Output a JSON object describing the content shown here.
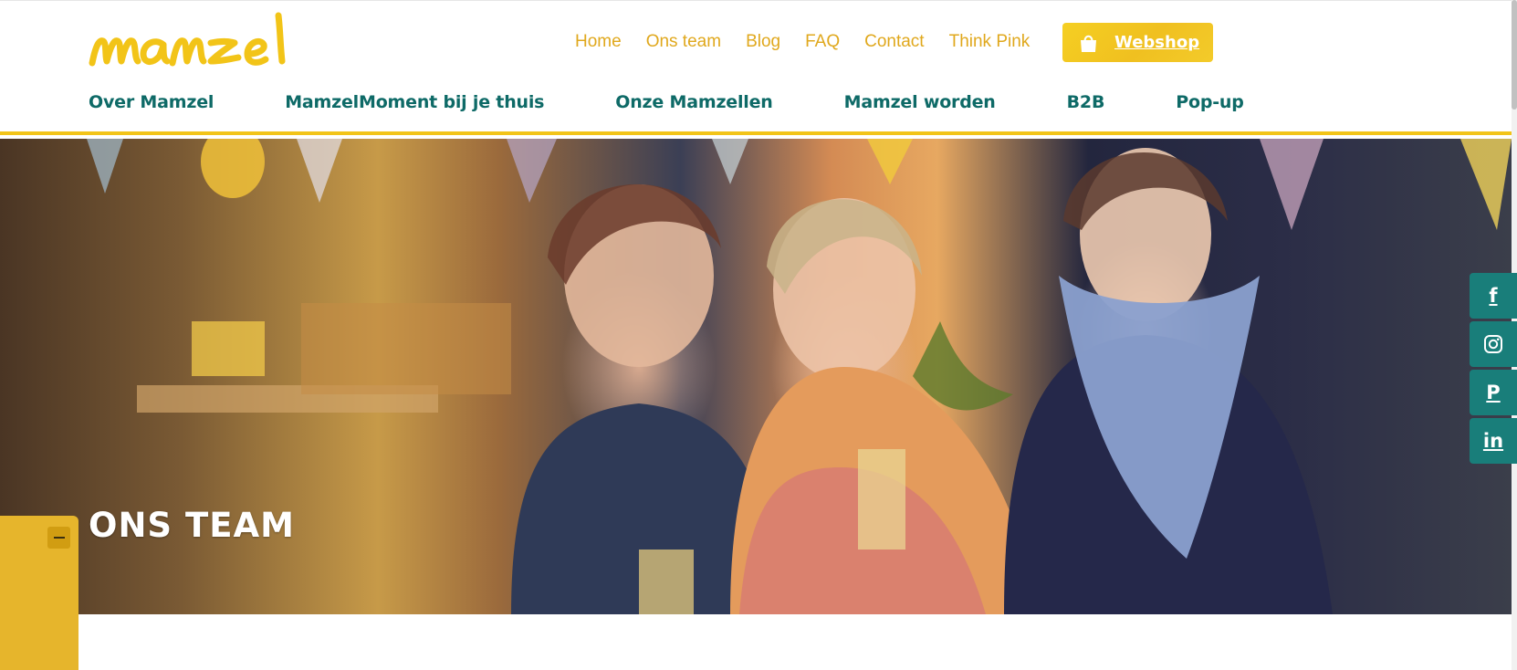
{
  "brand": {
    "logo_text": "mamzel",
    "accent_color": "#f2c418",
    "teal_color": "#0e6a67",
    "gold_text_color": "#e0a81d"
  },
  "top_nav": {
    "items": [
      "Home",
      "Ons team",
      "Blog",
      "FAQ",
      "Contact",
      "Think Pink"
    ]
  },
  "webshop": {
    "label": "Webshop",
    "icon": "shopping-bag-icon"
  },
  "main_nav": {
    "items": [
      "Over Mamzel",
      "MamzelMoment bij je thuis",
      "Onze Mamzellen",
      "Mamzel worden",
      "B2B",
      "Pop-up"
    ]
  },
  "hero": {
    "title": "ONS TEAM",
    "image": "photo of three smiling women in front of a shop window"
  },
  "side_panel": {
    "toggle_icon": "minus-icon"
  },
  "social": [
    {
      "name": "facebook",
      "icon": "facebook-icon",
      "glyph": "f"
    },
    {
      "name": "instagram",
      "icon": "instagram-icon",
      "glyph": ""
    },
    {
      "name": "pinterest",
      "icon": "pinterest-icon",
      "glyph": "P"
    },
    {
      "name": "linkedin",
      "icon": "linkedin-icon",
      "glyph": "in"
    }
  ]
}
